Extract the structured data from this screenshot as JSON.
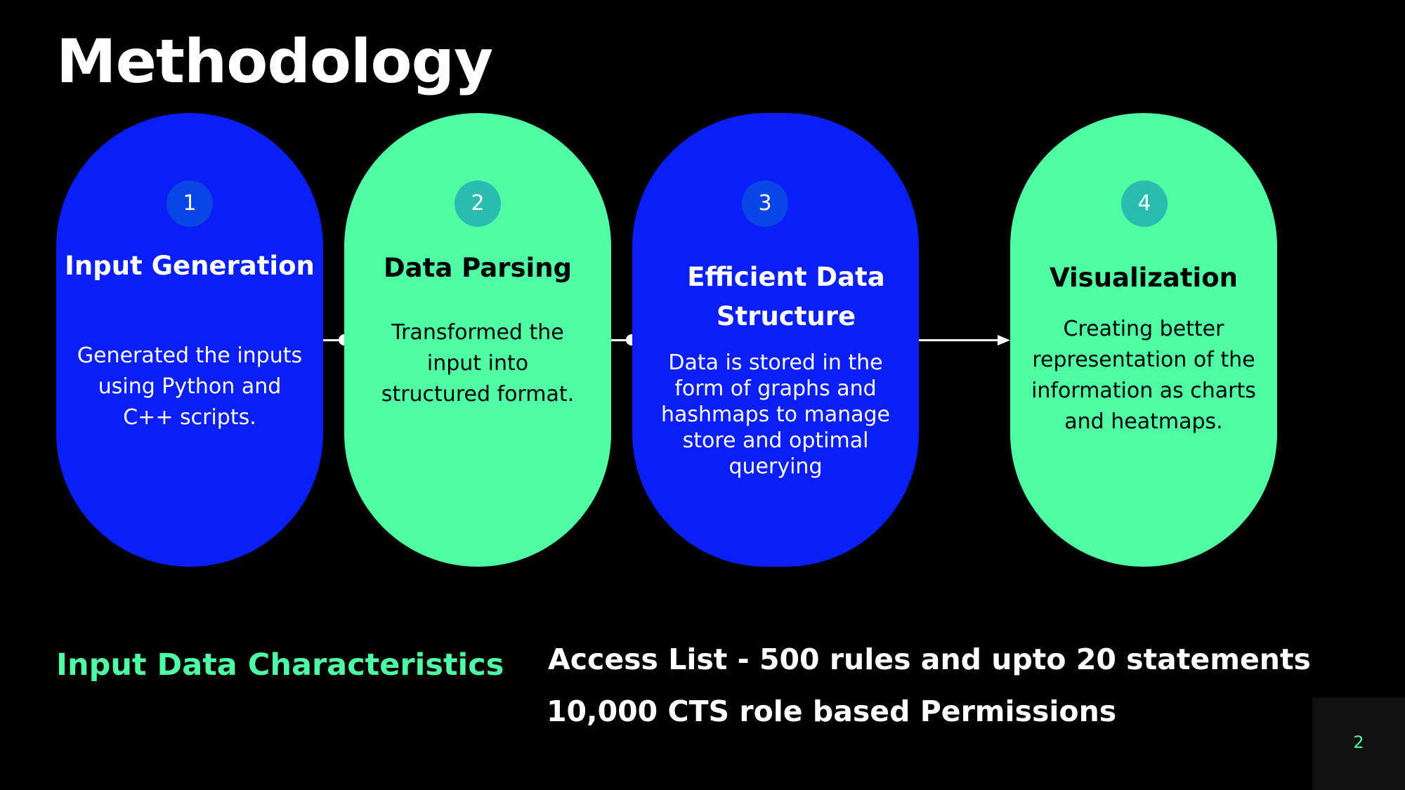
{
  "title": "Methodology",
  "steps": [
    {
      "number": "1",
      "title": "Input Generation",
      "description": "Generated the inputs using Python and C++ scripts."
    },
    {
      "number": "2",
      "title": "Data Parsing",
      "description": "Transformed the input into structured format."
    },
    {
      "number": "3",
      "title": "Efficient Data Structure",
      "description": "Data is stored in the form of graphs and hashmaps to manage store and optimal querying"
    },
    {
      "number": "4",
      "title": "Visualization",
      "description": "Creating better representation of the information as charts and heatmaps."
    }
  ],
  "characteristics": {
    "label": "Input Data Characteristics",
    "items": [
      "Access List - 500 rules and upto 20 statements",
      "10,000 CTS role based Permissions"
    ]
  },
  "page_number": "2",
  "colors": {
    "blue": "#0a1ff5",
    "green": "#4ffda4",
    "background": "#000000"
  }
}
